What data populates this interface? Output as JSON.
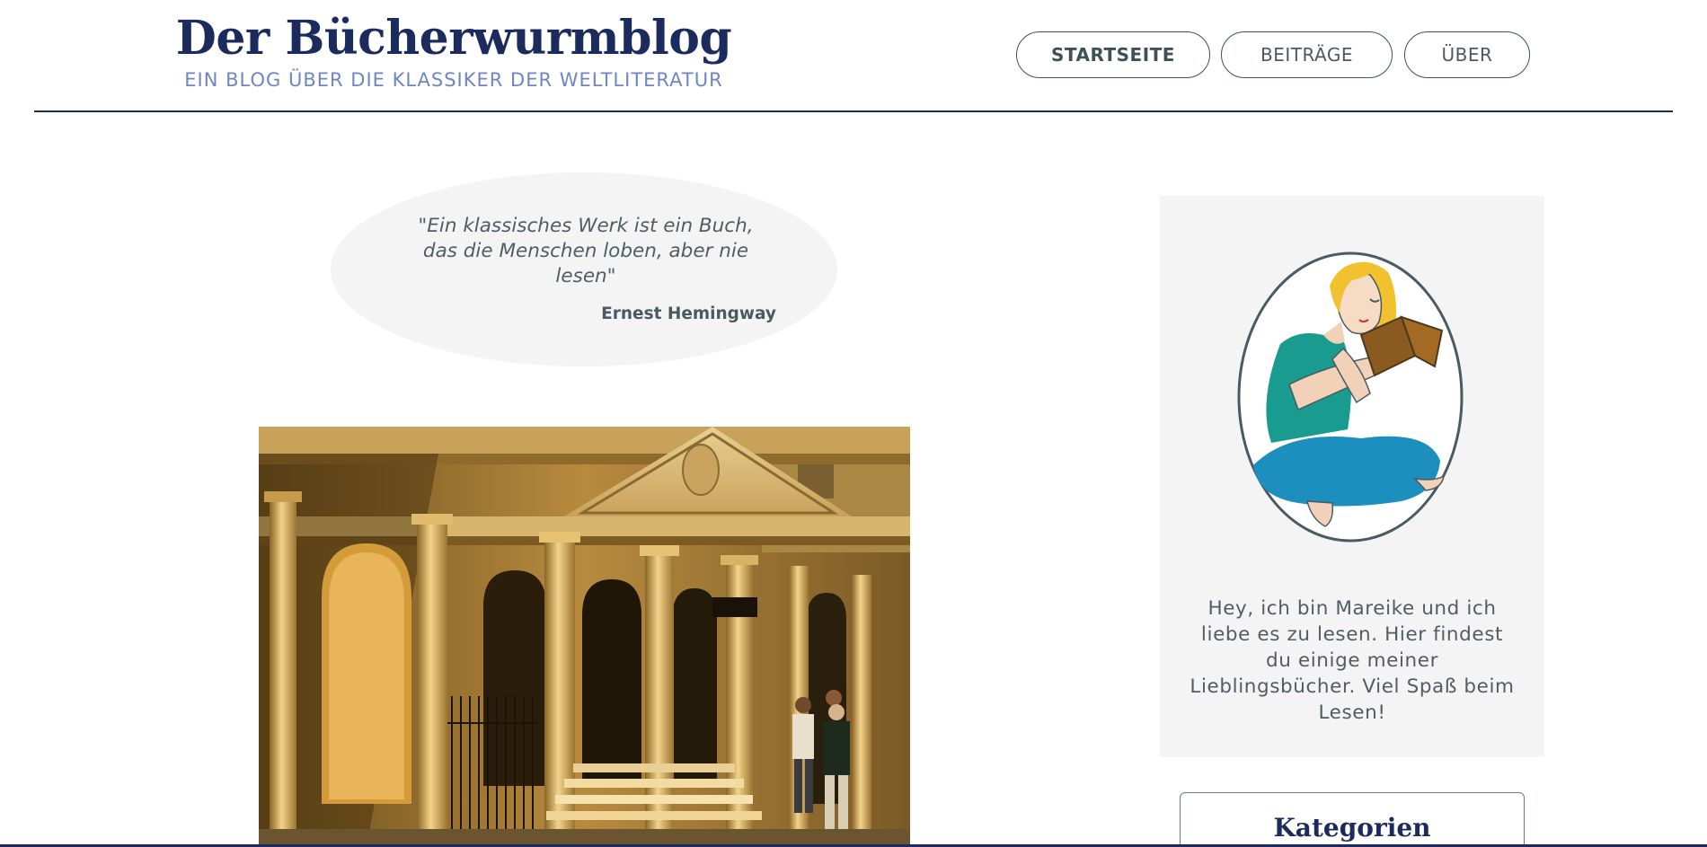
{
  "header": {
    "title": "Der Bücherwurmblog",
    "subtitle": "EIN BLOG ÜBER DIE KLASSIKER DER WELTLITERATUR"
  },
  "nav": {
    "items": [
      {
        "label": "STARTSEITE",
        "active": true
      },
      {
        "label": "BEITRÄGE",
        "active": false
      },
      {
        "label": "ÜBER",
        "active": false
      }
    ]
  },
  "quote": {
    "text": "\"Ein klassisches Werk ist ein Buch, das die Menschen loben, aber nie lesen\"",
    "author": "Ernest Hemingway"
  },
  "sidebar": {
    "bio": "Hey, ich bin Mareike und ich liebe es zu lesen. Hier findest du einige meiner Lieblingsbücher. Viel Spaß beim Lesen!",
    "categories_title": "Kategorien"
  },
  "colors": {
    "brand_navy": "#1c2b5e",
    "subtitle_blue": "#6f86c1",
    "text_gray": "#4a5a63",
    "panel_gray": "#f4f4f4"
  }
}
